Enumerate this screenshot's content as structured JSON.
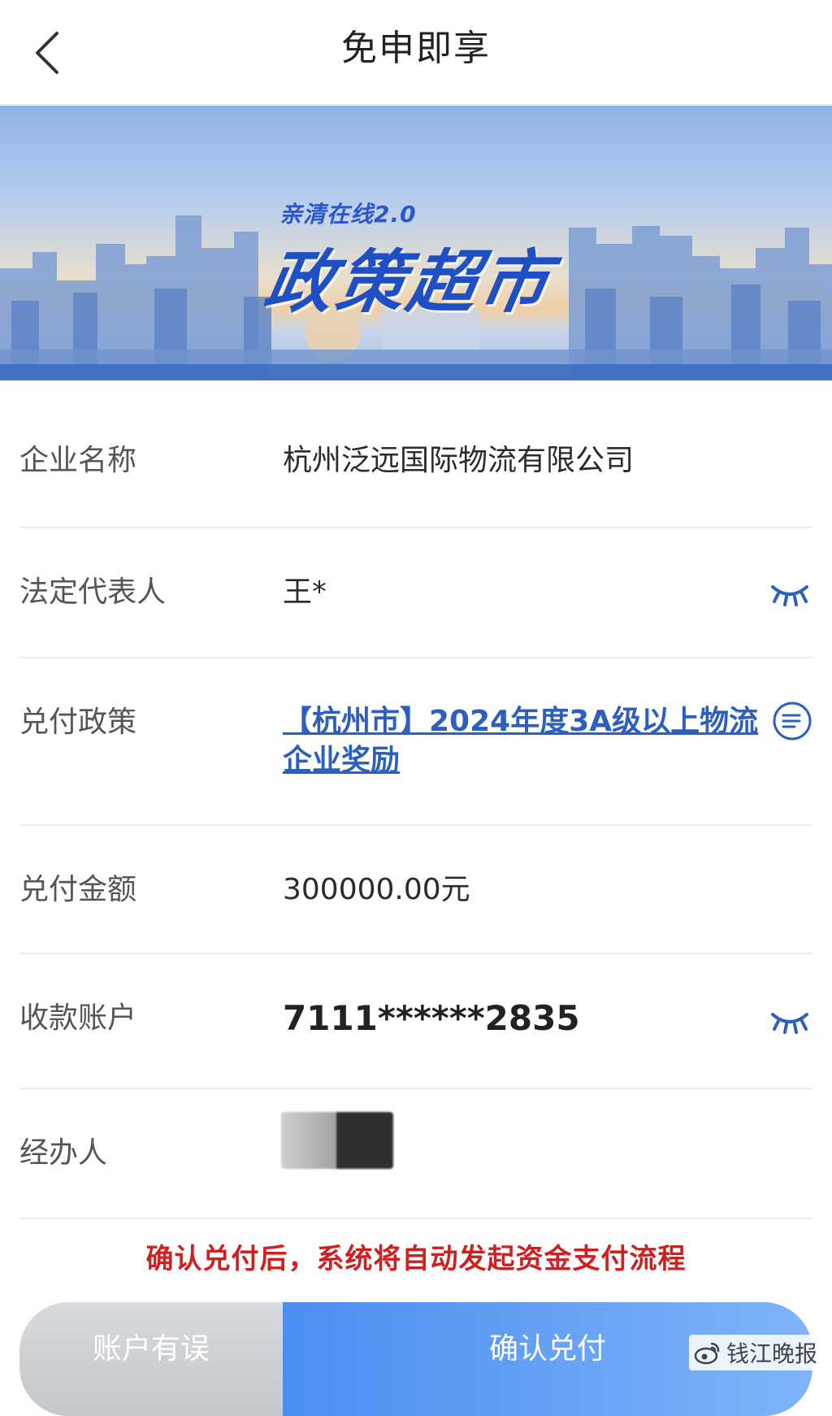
{
  "header": {
    "title": "免申即享",
    "back_icon": "chevron-left-icon"
  },
  "banner": {
    "subtitle": "亲清在线2.0",
    "title": "政策超市"
  },
  "fields": {
    "company_name": {
      "label": "企业名称",
      "value": "杭州泛远国际物流有限公司"
    },
    "legal_rep": {
      "label": "法定代表人",
      "value": "王*",
      "icon": "eye-closed-icon"
    },
    "policy": {
      "label": "兑付政策",
      "value": "【杭州市】2024年度3A级以上物流企业奖励",
      "icon": "list-icon"
    },
    "amount": {
      "label": "兑付金额",
      "value": "300000.00元"
    },
    "account": {
      "label": "收款账户",
      "value": "7111******2835",
      "icon": "eye-closed-icon"
    },
    "handler": {
      "label": "经办人"
    }
  },
  "notice": "确认兑付后，系统将自动发起资金支付流程",
  "buttons": {
    "reject_label": "账户有误",
    "confirm_label": "确认兑付"
  },
  "watermark": {
    "text": "钱江晚报",
    "icon": "weibo-icon"
  },
  "colors": {
    "link": "#2b5fc0",
    "notice": "#d01f1f",
    "confirm": "#4a8ef2",
    "reject": "#c4c7cb"
  }
}
